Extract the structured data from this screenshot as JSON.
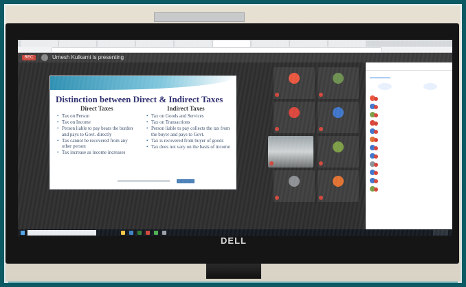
{
  "meet": {
    "recording_label": "REC",
    "presenting_text": "Umesh Kulkarni is presenting"
  },
  "slide": {
    "title": "Distinction between Direct & Indirect Taxes",
    "direct_header": "Direct Taxes",
    "indirect_header": "Indirect Taxes",
    "direct_points": [
      "Tax on Person",
      "Tax on Income",
      "Person liable to pay bears the burden and pays to Govt. directly",
      "Tax cannot be recovered from any other person",
      "Tax increase as income increases"
    ],
    "indirect_points": [
      "Tax on Goods and Services",
      "Tax on Transactions",
      "Person liable to pay collects the tax from the buyer and pays to Govt.",
      "Tax is recovered from buyer of goods",
      "Tax does not vary on the basis of income"
    ]
  },
  "colors": {
    "accent": "#1a73e8",
    "record": "#c8463b",
    "frame": "#0b5a63"
  }
}
